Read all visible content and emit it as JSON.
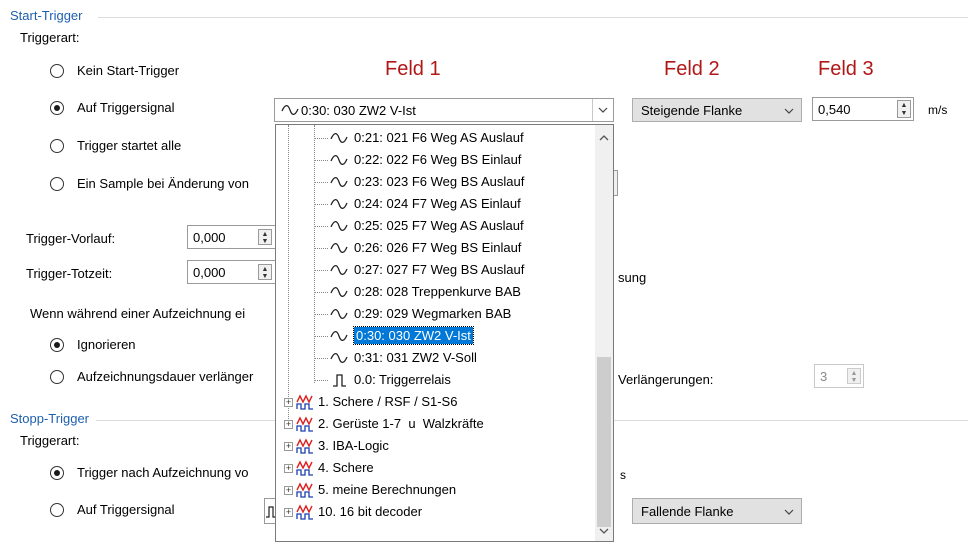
{
  "start_trigger": {
    "group_title": "Start-Trigger",
    "triggerart_label": "Triggerart:",
    "options": [
      {
        "label": "Kein Start-Trigger",
        "selected": false
      },
      {
        "label": "Auf Triggersignal",
        "selected": true
      },
      {
        "label": "Trigger startet alle",
        "selected": false
      },
      {
        "label": "Ein Sample bei Änderung von",
        "selected": false
      }
    ],
    "vorlauf_label": "Trigger-Vorlauf:",
    "vorlauf_value": "0,000",
    "totzeit_label": "Trigger-Totzeit:",
    "totzeit_value": "0,000",
    "totzeit_suffix": "sung",
    "during_label": "Wenn während einer Aufzeichnung ei",
    "during_options": [
      {
        "label": "Ignorieren",
        "selected": true
      },
      {
        "label": "Aufzeichnungsdauer verlänger",
        "selected": false
      }
    ],
    "verlaengerungen_label": "Verlängerungen:",
    "verlaengerungen_value": "3"
  },
  "feld_labels": {
    "feld1": "Feld 1",
    "feld2": "Feld 2",
    "feld3": "Feld 3"
  },
  "signal_select": {
    "value": "0:30: 030 ZW2 V-Ist",
    "icon": "analog-signal-icon"
  },
  "flank_select": {
    "value": "Steigende Flanke"
  },
  "value_field": {
    "value": "0,540",
    "unit": "m/s"
  },
  "signal_list": {
    "items": [
      {
        "label": "0:21: 021 F6 Weg AS Auslauf",
        "icon": "analog-signal-icon",
        "selected": false
      },
      {
        "label": "0:22: 022 F6 Weg BS Einlauf",
        "icon": "analog-signal-icon",
        "selected": false
      },
      {
        "label": "0:23: 023 F6 Weg BS Auslauf",
        "icon": "analog-signal-icon",
        "selected": false
      },
      {
        "label": "0:24: 024 F7 Weg AS Einlauf",
        "icon": "analog-signal-icon",
        "selected": false
      },
      {
        "label": "0:25: 025 F7 Weg AS Auslauf",
        "icon": "analog-signal-icon",
        "selected": false
      },
      {
        "label": "0:26: 026 F7 Weg BS Einlauf",
        "icon": "analog-signal-icon",
        "selected": false
      },
      {
        "label": "0:27: 027 F7 Weg BS Auslauf",
        "icon": "analog-signal-icon",
        "selected": false
      },
      {
        "label": "0:28: 028 Treppenkurve BAB",
        "icon": "analog-signal-icon",
        "selected": false
      },
      {
        "label": "0:29: 029 Wegmarken BAB",
        "icon": "analog-signal-icon",
        "selected": false
      },
      {
        "label": "0:30: 030 ZW2 V-Ist",
        "icon": "analog-signal-icon",
        "selected": true
      },
      {
        "label": "0:31: 031 ZW2 V-Soll",
        "icon": "analog-signal-icon",
        "selected": false
      },
      {
        "label": "0.0: Triggerrelais",
        "icon": "digital-signal-icon",
        "selected": false
      }
    ],
    "groups": [
      {
        "label": "1. Schere / RSF / S1-S6"
      },
      {
        "label": "2. Gerüste 1-7  u  Walzkräfte"
      },
      {
        "label": "3. IBA-Logic"
      },
      {
        "label": "4. Schere"
      },
      {
        "label": "5. meine Berechnungen"
      },
      {
        "label": "10. 16 bit decoder"
      }
    ]
  },
  "stop_trigger": {
    "group_title": "Stopp-Trigger",
    "triggerart_label": "Triggerart:",
    "options": [
      {
        "label": "Trigger nach Aufzeichnung vo",
        "selected": true
      },
      {
        "label": "Auf Triggersignal",
        "selected": false
      }
    ],
    "time_unit": "s",
    "flank_select": {
      "value": "Fallende Flanke"
    }
  }
}
